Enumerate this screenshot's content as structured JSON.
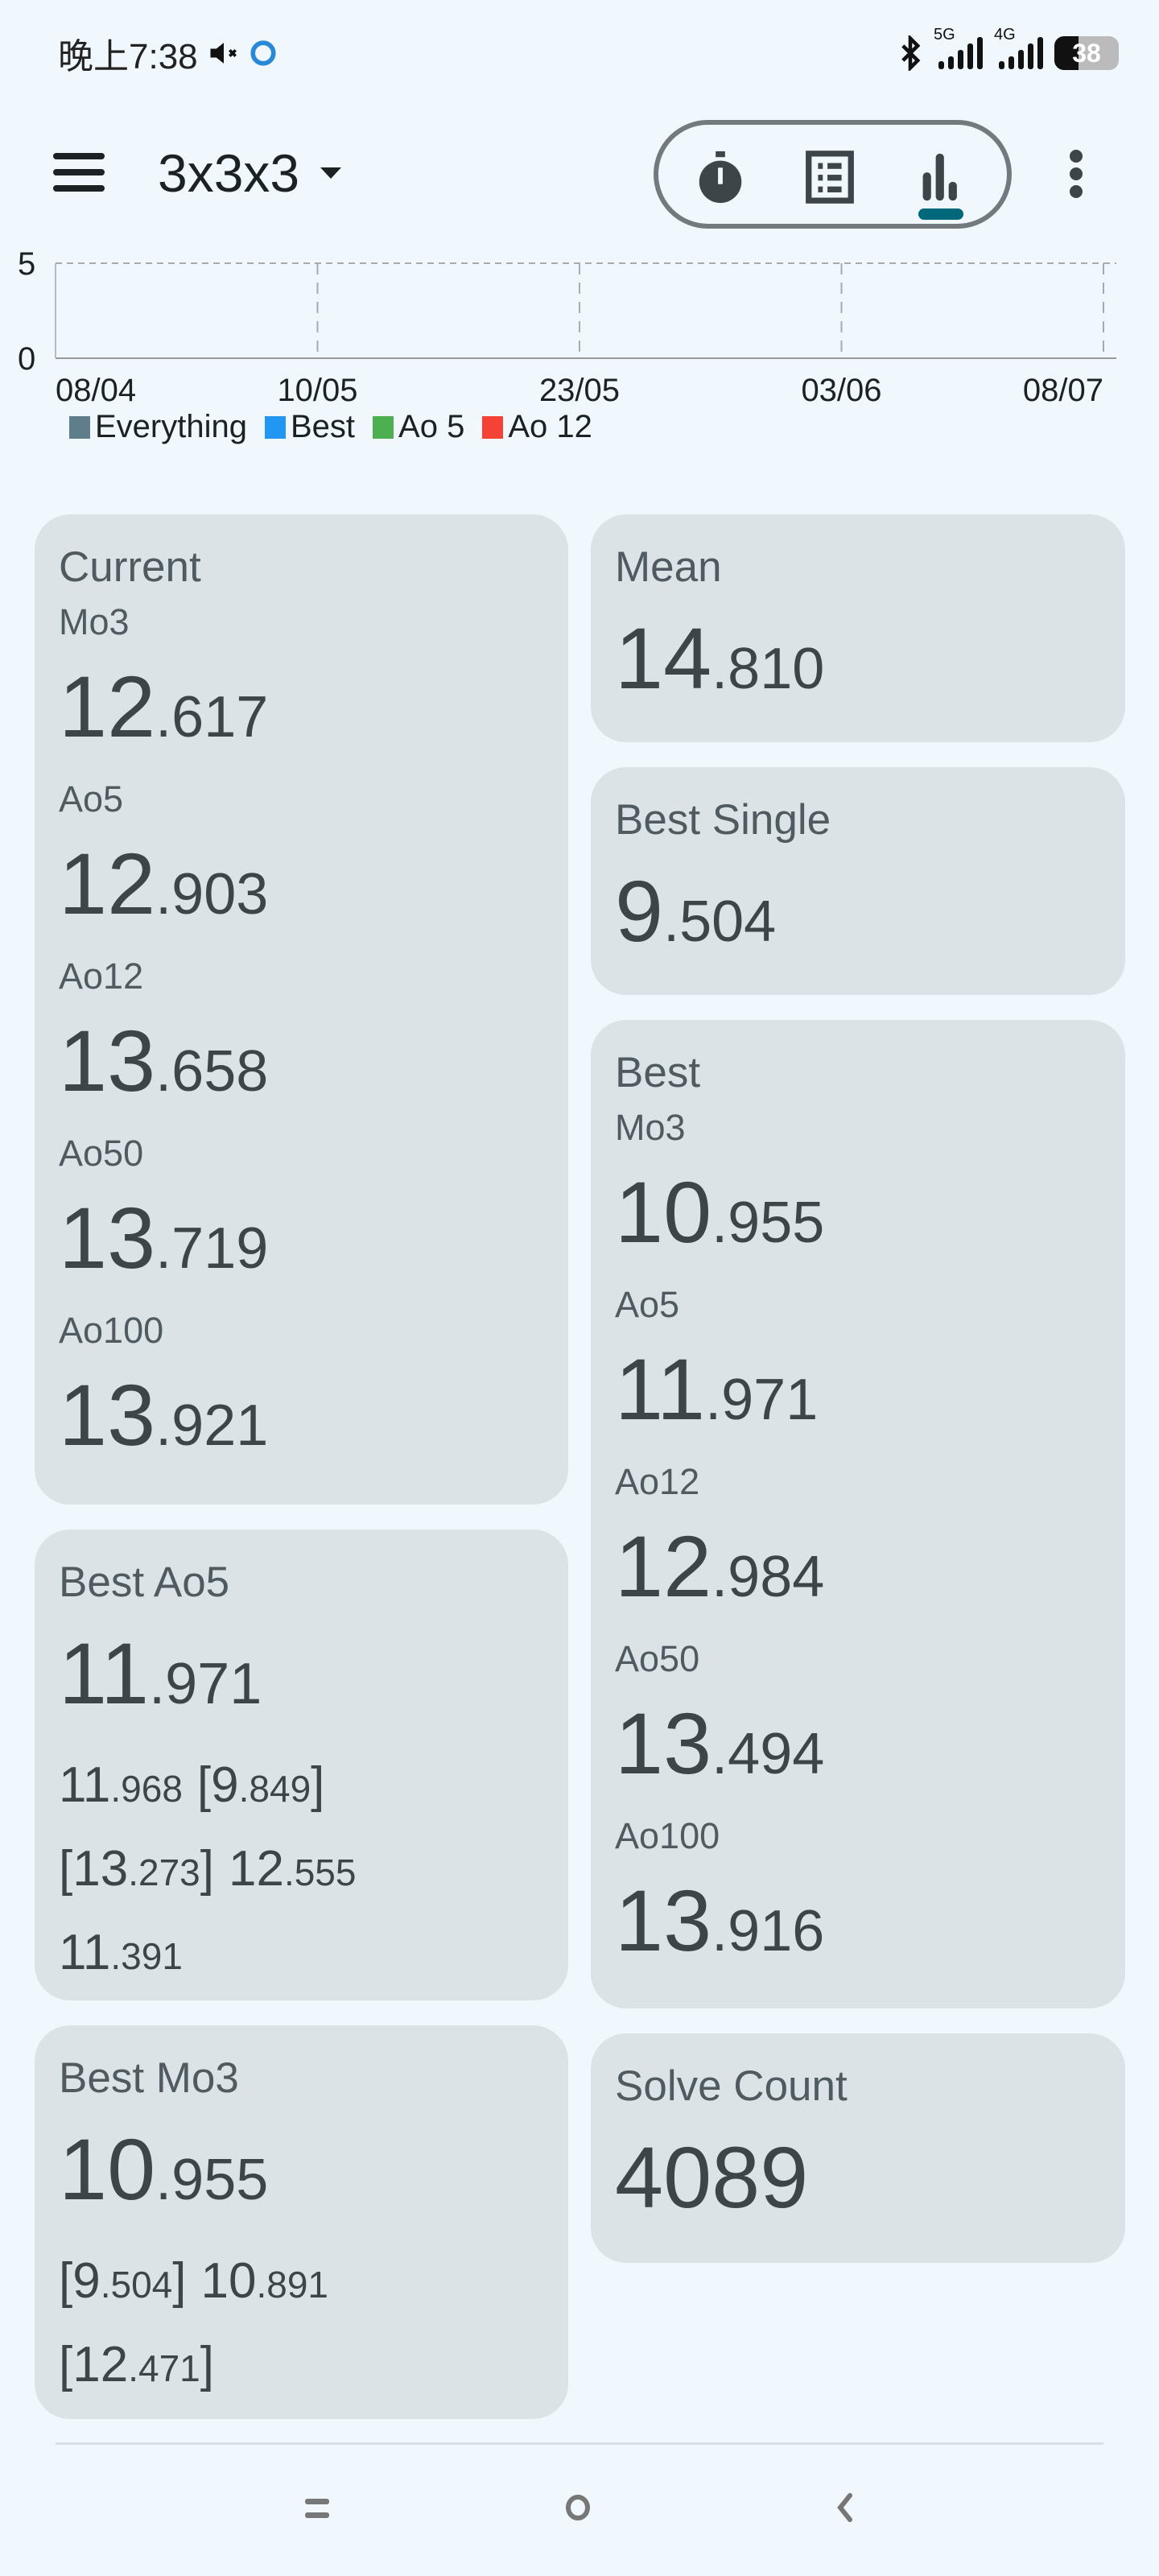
{
  "status_bar": {
    "time": "晚上7:38",
    "network_5g": "5G",
    "network_4g": "4G",
    "battery": "38"
  },
  "header": {
    "title": "3x3x3",
    "views": [
      "timer",
      "solves-list",
      "statistics"
    ],
    "active_view": "statistics"
  },
  "chart_data": {
    "type": "line",
    "y_tick_labels": [
      "0",
      "5"
    ],
    "x_tick_labels": [
      "08/04",
      "10/05",
      "23/05",
      "03/06",
      "08/07"
    ],
    "grid": true,
    "legend": {
      "placement": "bottom-left",
      "items": [
        {
          "name": "Everything",
          "color": "#607d8b"
        },
        {
          "name": "Best",
          "color": "#2196f3"
        },
        {
          "name": "Ao 5",
          "color": "#4caf50"
        },
        {
          "name": "Ao 12",
          "color": "#f44336"
        }
      ]
    }
  },
  "current": {
    "title": "Current",
    "rows": [
      {
        "label": "Mo3",
        "value": "12.617"
      },
      {
        "label": "Ao5",
        "value": "12.903"
      },
      {
        "label": "Ao12",
        "value": "13.658"
      },
      {
        "label": "Ao50",
        "value": "13.719"
      },
      {
        "label": "Ao100",
        "value": "13.921"
      }
    ]
  },
  "mean": {
    "title": "Mean",
    "value": "14.810"
  },
  "best_single": {
    "title": "Best Single",
    "value": "9.504"
  },
  "best": {
    "title": "Best",
    "rows": [
      {
        "label": "Mo3",
        "value": "10.955"
      },
      {
        "label": "Ao5",
        "value": "11.971"
      },
      {
        "label": "Ao12",
        "value": "12.984"
      },
      {
        "label": "Ao50",
        "value": "13.494"
      },
      {
        "label": "Ao100",
        "value": "13.916"
      }
    ]
  },
  "best_ao5": {
    "title": "Best Ao5",
    "value": "11.971",
    "times": [
      [
        "11.968",
        "[9.849]"
      ],
      [
        "[13.273]",
        "12.555"
      ],
      [
        "11.391"
      ]
    ]
  },
  "best_mo3": {
    "title": "Best Mo3",
    "value": "10.955",
    "times": [
      [
        "[9.504]",
        "10.891"
      ],
      [
        "[12.471]"
      ]
    ]
  },
  "solve_count": {
    "title": "Solve Count",
    "value": "4089"
  }
}
